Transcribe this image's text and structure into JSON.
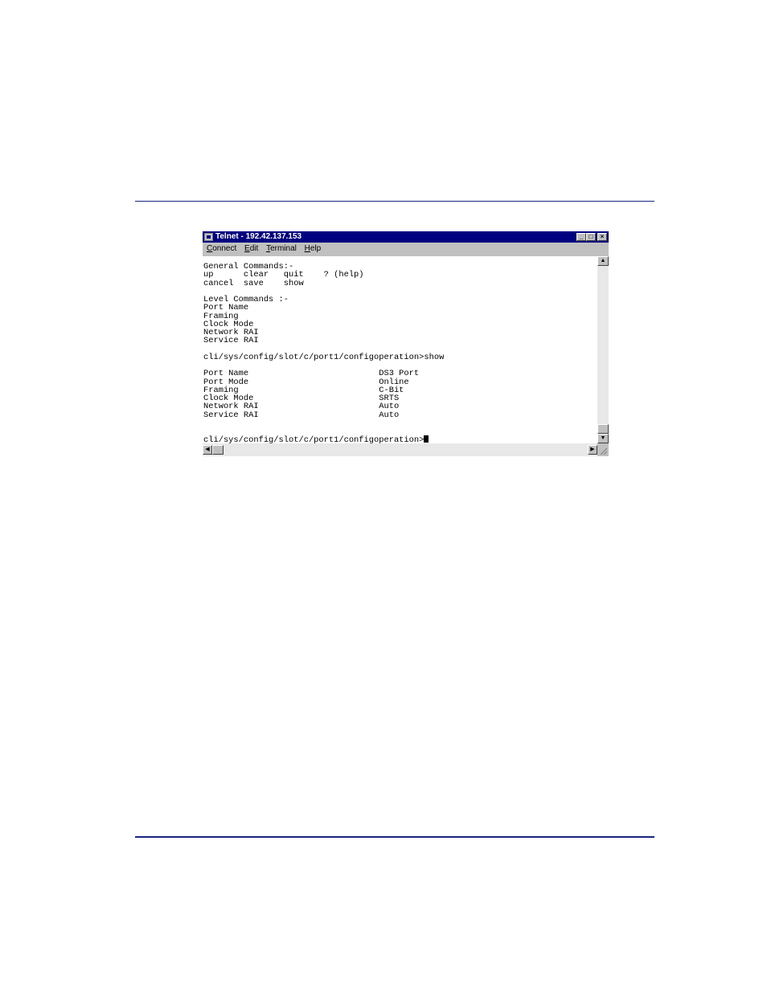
{
  "window": {
    "title": "Telnet - 192.42.137.153",
    "controls": {
      "minimize": "_",
      "maximize": "□",
      "close": "×"
    }
  },
  "menu": [
    {
      "label": "Connect",
      "accel": "C"
    },
    {
      "label": "Edit",
      "accel": "E"
    },
    {
      "label": "Terminal",
      "accel": "T"
    },
    {
      "label": "Help",
      "accel": "H"
    }
  ],
  "terminal": {
    "lines": [
      "General Commands:-",
      "up      clear   quit    ? (help)",
      "cancel  save    show",
      "",
      "Level Commands :-",
      "Port Name",
      "Framing",
      "Clock Mode",
      "Network RAI",
      "Service RAI",
      "",
      "cli/sys/config/slot/c/port1/configoperation>show",
      "",
      "Port Name                          DS3 Port",
      "Port Mode                          Online",
      "Framing                            C-Bit",
      "Clock Mode                         SRTS",
      "Network RAI                        Auto",
      "Service RAI                        Auto",
      "",
      ""
    ],
    "prompt": "cli/sys/config/slot/c/port1/configoperation>"
  },
  "scrollbar": {
    "up": "▲",
    "down": "▼",
    "left": "◀",
    "right": "▶"
  }
}
